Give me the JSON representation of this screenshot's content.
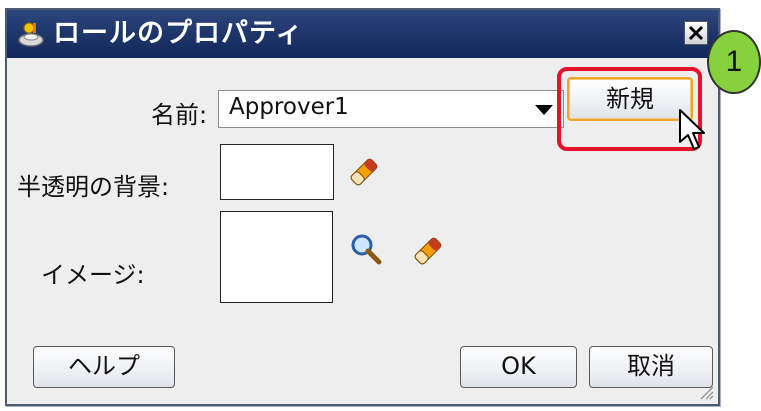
{
  "dialog": {
    "title": "ロールのプロパティ",
    "title_icon": "role-icon",
    "close_icon": "close-icon"
  },
  "fields": {
    "name_label": "名前:",
    "name_value": "Approver1",
    "translucent_bg_label": "半透明の背景:",
    "image_label": "イメージ:"
  },
  "buttons": {
    "new_label": "新規",
    "help_label": "ヘルプ",
    "ok_label": "OK",
    "cancel_label": "取消"
  },
  "annotation": {
    "step_number": "1"
  },
  "colors": {
    "title_bar": "#1c3468",
    "highlight": "#e8102a",
    "badge": "#86d23c",
    "button_focus": "#f0a430"
  }
}
